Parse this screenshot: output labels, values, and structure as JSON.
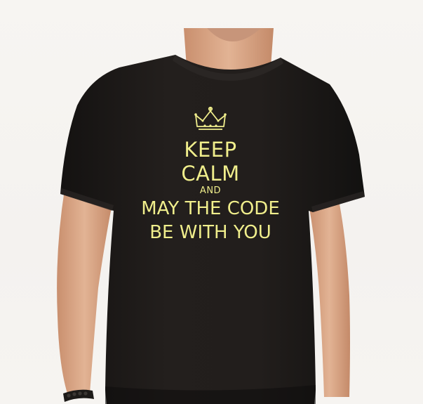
{
  "shirt_print": {
    "line1": "KEEP",
    "line2": "CALM",
    "line3": "AND",
    "line4": "MAY THE CODE",
    "line5": "BE WITH YOU",
    "crown_icon": "crown-icon"
  },
  "colors": {
    "shirt": "#1e1b19",
    "print_text": "#f0ee8c",
    "skin": "#d9a685",
    "background": "#ffffff"
  }
}
